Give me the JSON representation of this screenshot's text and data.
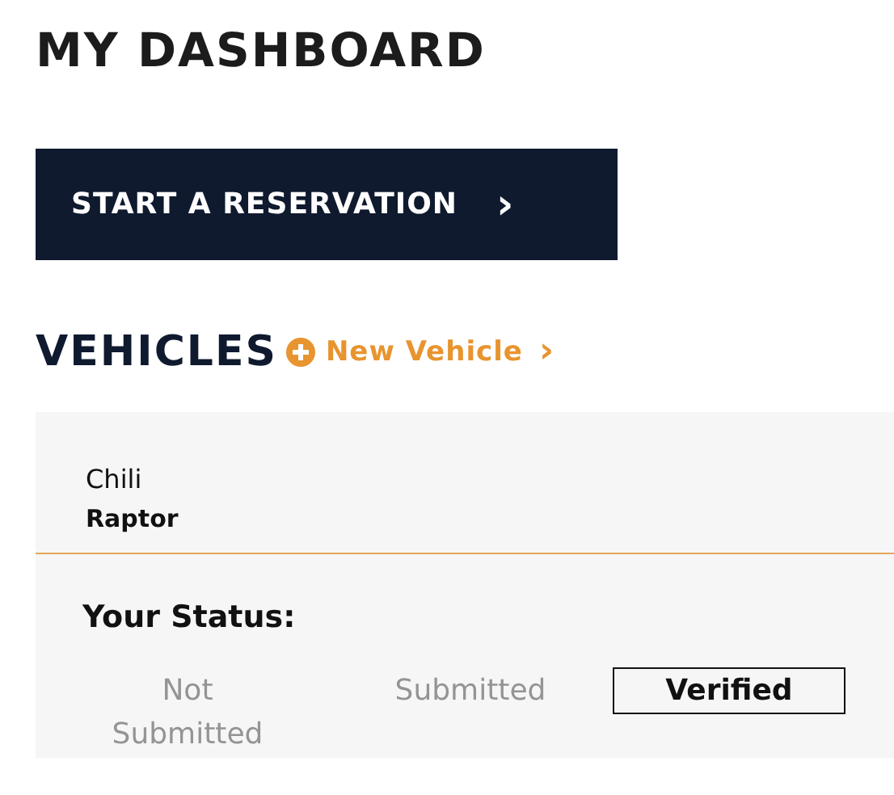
{
  "title": "MY DASHBOARD",
  "reservation_button": {
    "label": "START A RESERVATION",
    "chevron": "›"
  },
  "vehicles": {
    "heading": "VEHICLES",
    "new_vehicle_link": "New Vehicle",
    "link_chevron": "›",
    "card": {
      "name": "Chili",
      "model": "Raptor",
      "status_label": "Your Status:",
      "statuses": [
        {
          "label": "Not Submitted",
          "selected": false
        },
        {
          "label": "Submitted",
          "selected": false
        },
        {
          "label": "Verified",
          "selected": true
        }
      ]
    }
  }
}
